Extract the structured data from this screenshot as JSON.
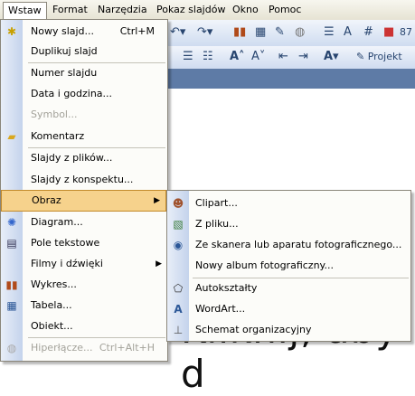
{
  "menubar": [
    "Wstaw",
    "Format",
    "Narzędzia",
    "Pokaz slajdów",
    "Okno",
    "Pomoc"
  ],
  "toolbar": {
    "projekt_label": "Projekt",
    "zoom_partial": "87"
  },
  "slide": {
    "text": "Kliknij, aby d"
  },
  "menu": {
    "items": [
      {
        "label": "Nowy slajd...",
        "shortcut": "Ctrl+M",
        "icon": "new-slide-icon"
      },
      {
        "label": "Duplikuj slajd",
        "shortcut": "",
        "icon": ""
      },
      {
        "label": "Numer slajdu",
        "shortcut": "",
        "icon": ""
      },
      {
        "label": "Data i godzina...",
        "shortcut": "",
        "icon": ""
      },
      {
        "label": "Symbol...",
        "shortcut": "",
        "icon": "",
        "disabled": true
      },
      {
        "label": "Komentarz",
        "shortcut": "",
        "icon": "comment-icon"
      },
      {
        "label": "Slajdy z plików...",
        "shortcut": "",
        "icon": ""
      },
      {
        "label": "Slajdy z konspektu...",
        "shortcut": "",
        "icon": ""
      },
      {
        "label": "Obraz",
        "shortcut": "",
        "icon": "",
        "submenu": true,
        "highlight": true
      },
      {
        "label": "Diagram...",
        "shortcut": "",
        "icon": "diagram-icon"
      },
      {
        "label": "Pole tekstowe",
        "shortcut": "",
        "icon": "textbox-icon"
      },
      {
        "label": "Filmy i dźwięki",
        "shortcut": "",
        "icon": "",
        "submenu": true
      },
      {
        "label": "Wykres...",
        "shortcut": "",
        "icon": "chart-icon"
      },
      {
        "label": "Tabela...",
        "shortcut": "",
        "icon": "table-icon"
      },
      {
        "label": "Obiekt...",
        "shortcut": "",
        "icon": ""
      },
      {
        "label": "Hiperłącze...",
        "shortcut": "Ctrl+Alt+H",
        "icon": "hyperlink-icon",
        "disabled": true
      }
    ]
  },
  "submenu": {
    "items": [
      {
        "label": "Clipart...",
        "icon": "clipart-icon"
      },
      {
        "label": "Z pliku...",
        "icon": "picture-file-icon"
      },
      {
        "label": "Ze skanera lub aparatu fotograficznego...",
        "icon": "scanner-icon"
      },
      {
        "label": "Nowy album fotograficzny...",
        "icon": ""
      },
      {
        "label": "Autokształty",
        "icon": "autoshapes-icon"
      },
      {
        "label": "WordArt...",
        "icon": "wordart-icon"
      },
      {
        "label": "Schemat organizacyjny",
        "icon": "org-chart-icon"
      }
    ]
  }
}
